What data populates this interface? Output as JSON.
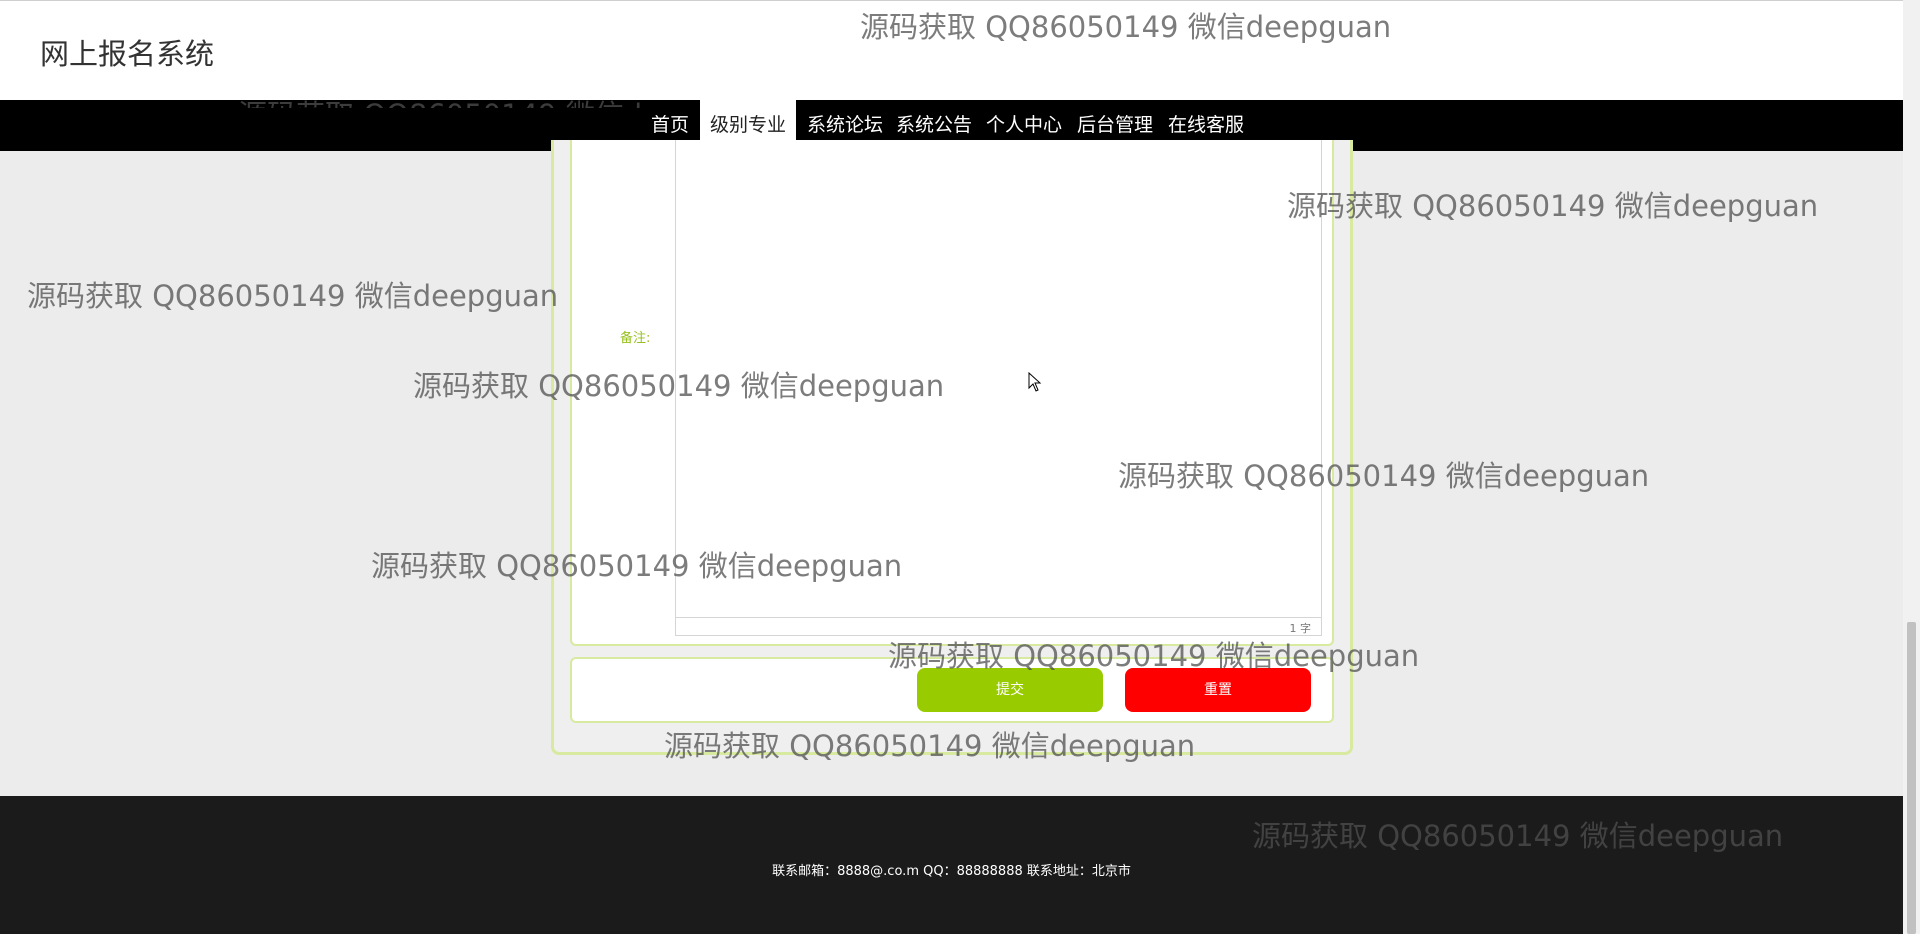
{
  "header": {
    "title": "网上报名系统"
  },
  "nav": {
    "items": [
      {
        "label": "首页"
      },
      {
        "label": "级别专业"
      },
      {
        "label": "系统论坛"
      },
      {
        "label": "系统公告"
      },
      {
        "label": "个人中心"
      },
      {
        "label": "后台管理"
      },
      {
        "label": "在线客服"
      }
    ],
    "active_index": 1
  },
  "form": {
    "remark_label": "备注:",
    "editor_value": "",
    "word_count": "1 字",
    "submit_label": "提交",
    "reset_label": "重置"
  },
  "footer": {
    "text": "联系邮箱：8888@.co.m QQ：88888888 联系地址：北京市"
  },
  "watermark": {
    "text": "源码获取 QQ86050149 微信deepguan",
    "partial_text": "源码获取 QQ86050149 微信deepguan"
  },
  "colors": {
    "nav_bg": "#000000",
    "accent_green": "#99cc00",
    "reset_red": "#ff0000",
    "panel_border": "#d7ea9f",
    "footer_bg": "#1b1b1b",
    "page_bg": "#ececec"
  }
}
